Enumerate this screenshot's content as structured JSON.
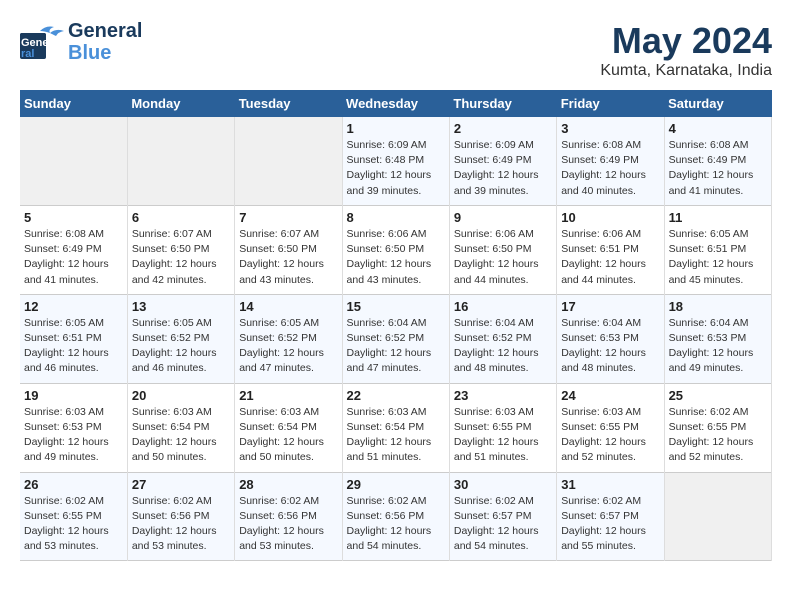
{
  "logo": {
    "line1": "General",
    "line2": "Blue"
  },
  "title": "May 2024",
  "location": "Kumta, Karnataka, India",
  "days_header": [
    "Sunday",
    "Monday",
    "Tuesday",
    "Wednesday",
    "Thursday",
    "Friday",
    "Saturday"
  ],
  "weeks": [
    [
      {
        "day": "",
        "info": ""
      },
      {
        "day": "",
        "info": ""
      },
      {
        "day": "",
        "info": ""
      },
      {
        "day": "1",
        "info": "Sunrise: 6:09 AM\nSunset: 6:48 PM\nDaylight: 12 hours\nand 39 minutes."
      },
      {
        "day": "2",
        "info": "Sunrise: 6:09 AM\nSunset: 6:49 PM\nDaylight: 12 hours\nand 39 minutes."
      },
      {
        "day": "3",
        "info": "Sunrise: 6:08 AM\nSunset: 6:49 PM\nDaylight: 12 hours\nand 40 minutes."
      },
      {
        "day": "4",
        "info": "Sunrise: 6:08 AM\nSunset: 6:49 PM\nDaylight: 12 hours\nand 41 minutes."
      }
    ],
    [
      {
        "day": "5",
        "info": "Sunrise: 6:08 AM\nSunset: 6:49 PM\nDaylight: 12 hours\nand 41 minutes."
      },
      {
        "day": "6",
        "info": "Sunrise: 6:07 AM\nSunset: 6:50 PM\nDaylight: 12 hours\nand 42 minutes."
      },
      {
        "day": "7",
        "info": "Sunrise: 6:07 AM\nSunset: 6:50 PM\nDaylight: 12 hours\nand 43 minutes."
      },
      {
        "day": "8",
        "info": "Sunrise: 6:06 AM\nSunset: 6:50 PM\nDaylight: 12 hours\nand 43 minutes."
      },
      {
        "day": "9",
        "info": "Sunrise: 6:06 AM\nSunset: 6:50 PM\nDaylight: 12 hours\nand 44 minutes."
      },
      {
        "day": "10",
        "info": "Sunrise: 6:06 AM\nSunset: 6:51 PM\nDaylight: 12 hours\nand 44 minutes."
      },
      {
        "day": "11",
        "info": "Sunrise: 6:05 AM\nSunset: 6:51 PM\nDaylight: 12 hours\nand 45 minutes."
      }
    ],
    [
      {
        "day": "12",
        "info": "Sunrise: 6:05 AM\nSunset: 6:51 PM\nDaylight: 12 hours\nand 46 minutes."
      },
      {
        "day": "13",
        "info": "Sunrise: 6:05 AM\nSunset: 6:52 PM\nDaylight: 12 hours\nand 46 minutes."
      },
      {
        "day": "14",
        "info": "Sunrise: 6:05 AM\nSunset: 6:52 PM\nDaylight: 12 hours\nand 47 minutes."
      },
      {
        "day": "15",
        "info": "Sunrise: 6:04 AM\nSunset: 6:52 PM\nDaylight: 12 hours\nand 47 minutes."
      },
      {
        "day": "16",
        "info": "Sunrise: 6:04 AM\nSunset: 6:52 PM\nDaylight: 12 hours\nand 48 minutes."
      },
      {
        "day": "17",
        "info": "Sunrise: 6:04 AM\nSunset: 6:53 PM\nDaylight: 12 hours\nand 48 minutes."
      },
      {
        "day": "18",
        "info": "Sunrise: 6:04 AM\nSunset: 6:53 PM\nDaylight: 12 hours\nand 49 minutes."
      }
    ],
    [
      {
        "day": "19",
        "info": "Sunrise: 6:03 AM\nSunset: 6:53 PM\nDaylight: 12 hours\nand 49 minutes."
      },
      {
        "day": "20",
        "info": "Sunrise: 6:03 AM\nSunset: 6:54 PM\nDaylight: 12 hours\nand 50 minutes."
      },
      {
        "day": "21",
        "info": "Sunrise: 6:03 AM\nSunset: 6:54 PM\nDaylight: 12 hours\nand 50 minutes."
      },
      {
        "day": "22",
        "info": "Sunrise: 6:03 AM\nSunset: 6:54 PM\nDaylight: 12 hours\nand 51 minutes."
      },
      {
        "day": "23",
        "info": "Sunrise: 6:03 AM\nSunset: 6:55 PM\nDaylight: 12 hours\nand 51 minutes."
      },
      {
        "day": "24",
        "info": "Sunrise: 6:03 AM\nSunset: 6:55 PM\nDaylight: 12 hours\nand 52 minutes."
      },
      {
        "day": "25",
        "info": "Sunrise: 6:02 AM\nSunset: 6:55 PM\nDaylight: 12 hours\nand 52 minutes."
      }
    ],
    [
      {
        "day": "26",
        "info": "Sunrise: 6:02 AM\nSunset: 6:55 PM\nDaylight: 12 hours\nand 53 minutes."
      },
      {
        "day": "27",
        "info": "Sunrise: 6:02 AM\nSunset: 6:56 PM\nDaylight: 12 hours\nand 53 minutes."
      },
      {
        "day": "28",
        "info": "Sunrise: 6:02 AM\nSunset: 6:56 PM\nDaylight: 12 hours\nand 53 minutes."
      },
      {
        "day": "29",
        "info": "Sunrise: 6:02 AM\nSunset: 6:56 PM\nDaylight: 12 hours\nand 54 minutes."
      },
      {
        "day": "30",
        "info": "Sunrise: 6:02 AM\nSunset: 6:57 PM\nDaylight: 12 hours\nand 54 minutes."
      },
      {
        "day": "31",
        "info": "Sunrise: 6:02 AM\nSunset: 6:57 PM\nDaylight: 12 hours\nand 55 minutes."
      },
      {
        "day": "",
        "info": ""
      }
    ]
  ]
}
